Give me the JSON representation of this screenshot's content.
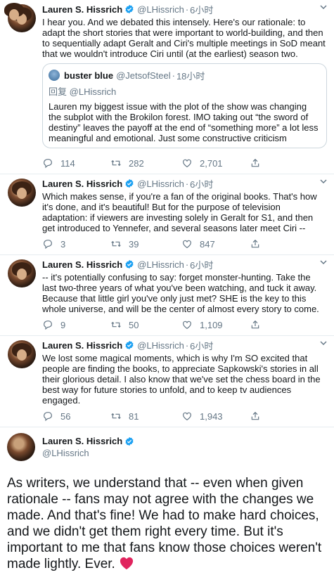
{
  "tweets": [
    {
      "name": "Lauren S. Hissrich",
      "handle": "@LHissrich",
      "time": "6小时",
      "text": "I hear you. And we debated this intensely. Here's our rationale: to adapt the short stories that were important to world-building, and then to sequentially adapt Geralt and Ciri's multiple meetings in SoD meant that we wouldn't introduce Ciri until (at the earliest) season two.",
      "quote": {
        "name": "buster blue",
        "handle": "@JetsofSteel",
        "time": "18小时",
        "reply_prefix": "回复",
        "reply_to": "@LHissrich",
        "text": "Lauren my biggest issue with the plot of the show was changing the subplot with the Brokilon forest. IMO taking out “the sword of destiny” leaves the payoff at the end of “something more” a lot less meaningful and emotional. Just some constructive criticism"
      },
      "replies": "114",
      "retweets": "282",
      "likes": "2,701"
    },
    {
      "name": "Lauren S. Hissrich",
      "handle": "@LHissrich",
      "time": "6小时",
      "text": "Which makes sense, if you're a fan of the original books. That's how it's done, and it's beautiful! But for the purpose of television adaptation: if viewers are investing solely in Geralt for S1, and then get introduced to Yennefer, and several seasons later meet Ciri  --",
      "replies": "3",
      "retweets": "39",
      "likes": "847"
    },
    {
      "name": "Lauren S. Hissrich",
      "handle": "@LHissrich",
      "time": "6小时",
      "text": "-- it's potentially confusing to say: forget monster-hunting. Take the last two-three years of what you've been watching, and tuck it away. Because that little girl you've only just met? SHE is the key to this whole universe, and will be the center of almost every story to come.",
      "replies": "9",
      "retweets": "50",
      "likes": "1,109"
    },
    {
      "name": "Lauren S. Hissrich",
      "handle": "@LHissrich",
      "time": "6小时",
      "text": "We lost some magical moments, which is why I'm SO excited that people are finding the books, to appreciate Sapkowski's stories in all their glorious detail. I also know that we've set the chess board in the best way for future stories to unfold, and to keep tv audiences engaged.",
      "replies": "56",
      "retweets": "81",
      "likes": "1,943"
    }
  ],
  "main": {
    "name": "Lauren S. Hissrich",
    "handle": "@LHissrich",
    "text": "As writers, we understand that -- even when given rationale -- fans may not agree with the changes we made. And that's fine! We had to make hard choices, and we didn't get them right every time. But it's important to me that fans know those choices weren't made lightly. Ever."
  },
  "colors": {
    "verified": "#1da1f2",
    "secondary": "#657786",
    "heart": "#e0245e",
    "border": "#e6ecf0"
  },
  "icons": [
    "verified-icon",
    "chevron-down-icon",
    "reply-icon",
    "retweet-icon",
    "like-icon",
    "share-icon",
    "heart-emoji"
  ]
}
